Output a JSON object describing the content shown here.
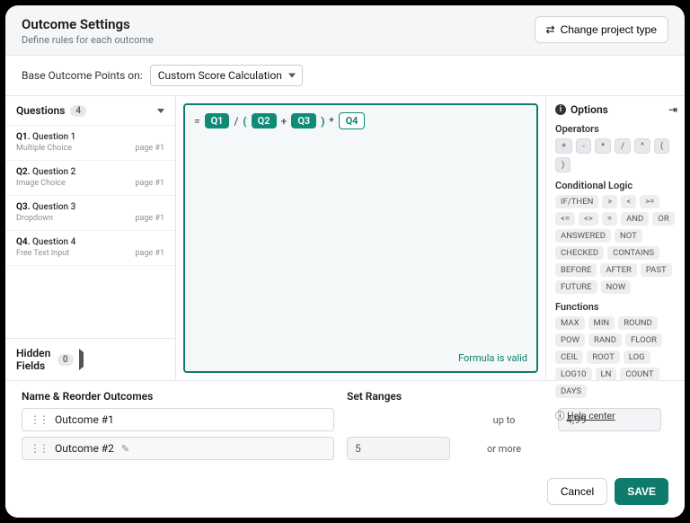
{
  "header": {
    "title": "Outcome Settings",
    "subtitle": "Define rules for each outcome",
    "change_project_btn": "Change project type"
  },
  "basebar": {
    "label": "Base Outcome Points on:",
    "select_value": "Custom Score Calculation"
  },
  "questions_panel": {
    "title": "Questions",
    "count": "4",
    "items": [
      {
        "no": "Q1.",
        "title": "Question 1",
        "type": "Multiple Choice",
        "page": "page #1"
      },
      {
        "no": "Q2.",
        "title": "Question 2",
        "type": "Image Choice",
        "page": "page #1"
      },
      {
        "no": "Q3.",
        "title": "Question 3",
        "type": "Dropdown",
        "page": "page #1"
      },
      {
        "no": "Q4.",
        "title": "Question 4",
        "type": "Free Text Input",
        "page": "page #1"
      }
    ]
  },
  "hidden_fields": {
    "title": "Hidden Fields",
    "count": "0"
  },
  "formula": {
    "eq": "=",
    "tokens": {
      "q1": "Q1",
      "div": "/",
      "lp": "(",
      "q2": "Q2",
      "plus": "+",
      "q3": "Q3",
      "rp": ")",
      "mul": "*",
      "q4": "Q4"
    },
    "valid_msg": "Formula is valid"
  },
  "options": {
    "title": "Options",
    "operators_title": "Operators",
    "operators": [
      "+",
      "-",
      "*",
      "/",
      "^",
      "(",
      ")"
    ],
    "cond_title": "Conditional Logic",
    "cond": [
      "IF/THEN",
      ">",
      "<",
      ">=",
      "<=",
      "<>",
      "=",
      "AND",
      "OR",
      "ANSWERED",
      "NOT",
      "CHECKED",
      "CONTAINS",
      "BEFORE",
      "AFTER",
      "PAST",
      "FUTURE",
      "NOW"
    ],
    "func_title": "Functions",
    "funcs": [
      "MAX",
      "MIN",
      "ROUND",
      "POW",
      "RAND",
      "FLOOR",
      "CEIL",
      "ROOT",
      "LOG",
      "LOG10",
      "LN",
      "COUNT",
      "DAYS"
    ],
    "help": "Help center"
  },
  "outcomes": {
    "name_header": "Name & Reorder Outcomes",
    "range_header": "Set Ranges",
    "upto": "up to",
    "ormore": "or more",
    "rows": [
      {
        "name": "Outcome #1",
        "from": "",
        "to": "4,99",
        "editable": false
      },
      {
        "name": "Outcome #2",
        "from": "5",
        "to": "",
        "editable": true
      }
    ]
  },
  "footer": {
    "cancel": "Cancel",
    "save": "SAVE"
  }
}
